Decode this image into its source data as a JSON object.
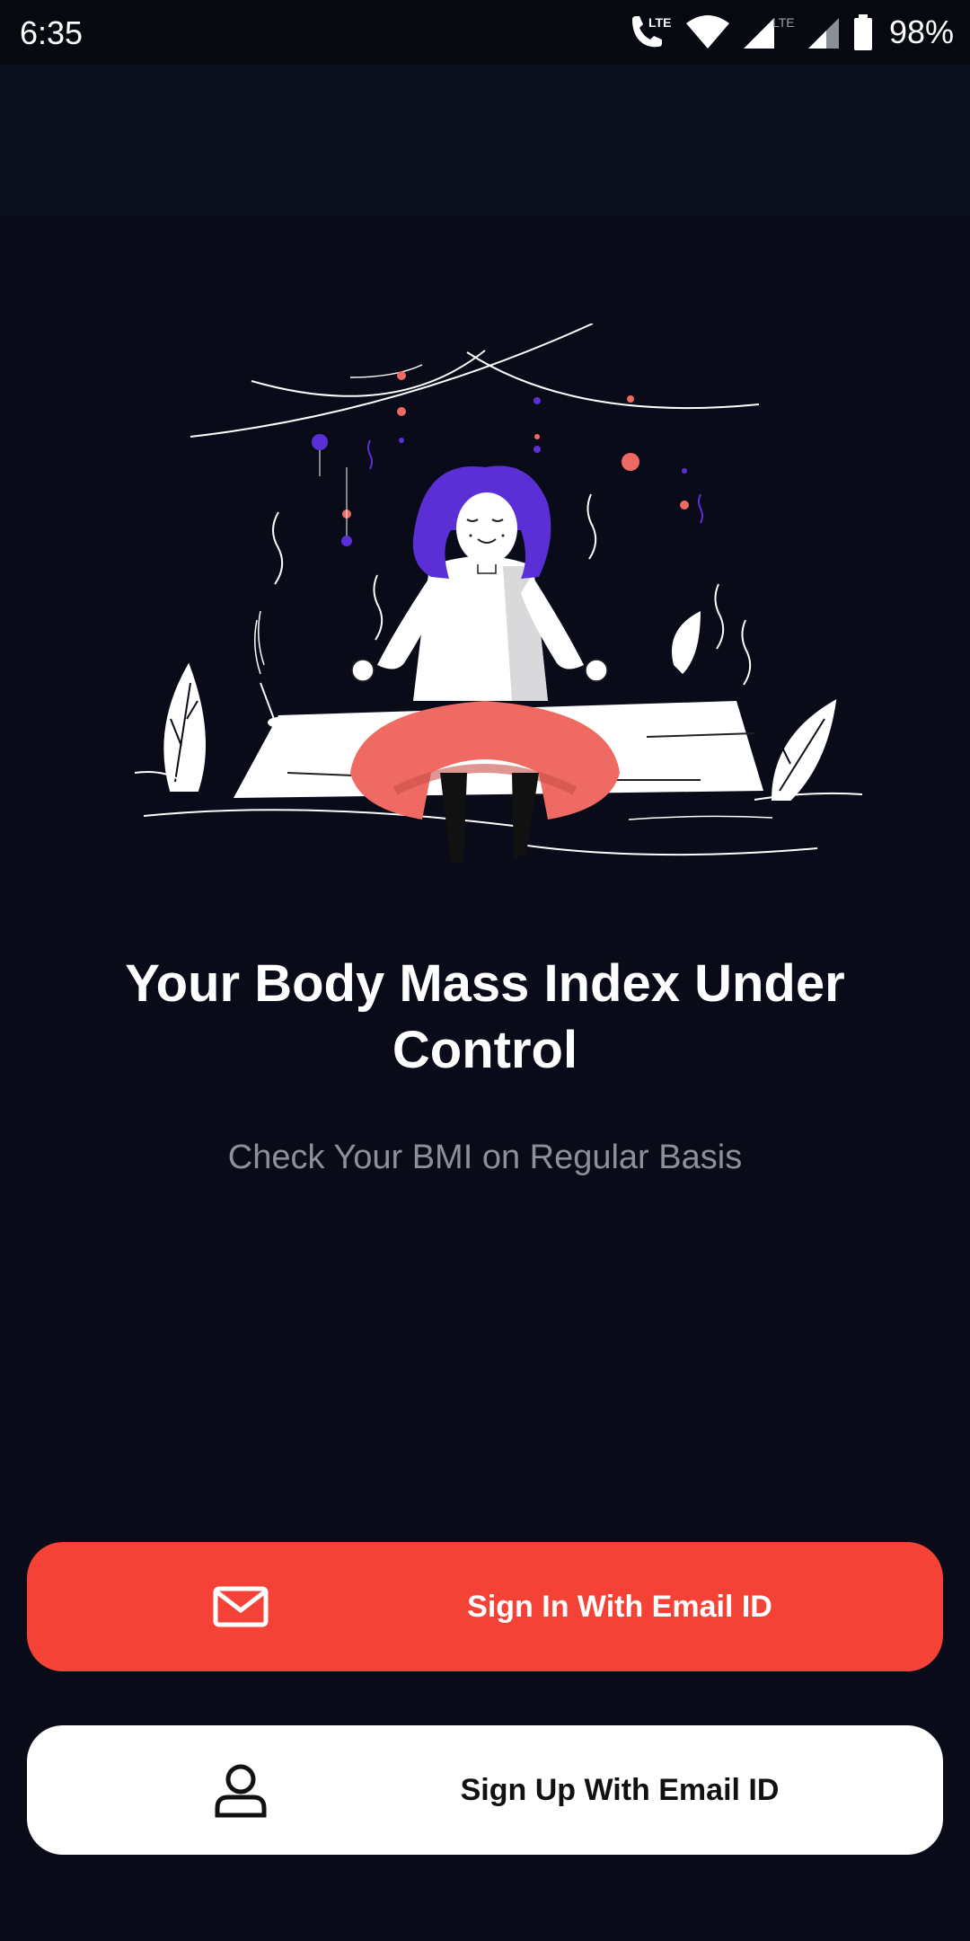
{
  "status_bar": {
    "time": "6:35",
    "battery_percent": "98%",
    "icons": [
      "lte-call-icon",
      "wifi-icon",
      "signal-lte-icon",
      "signal-icon",
      "battery-icon"
    ],
    "lte_label_1": "LTE",
    "lte_label_2": "LTE"
  },
  "onboarding": {
    "illustration": "meditating-woman-illustration",
    "headline": "Your Body Mass Index Under Control",
    "subtitle": "Check Your BMI on Regular Basis"
  },
  "actions": {
    "sign_in_label": "Sign In With Email ID",
    "sign_in_icon": "mail-icon",
    "sign_up_label": "Sign Up With Email ID",
    "sign_up_icon": "user-icon"
  },
  "colors": {
    "background": "#090b18",
    "primary": "#f44336",
    "accent_purple": "#5b2fd6",
    "accent_coral": "#ee6a62"
  }
}
